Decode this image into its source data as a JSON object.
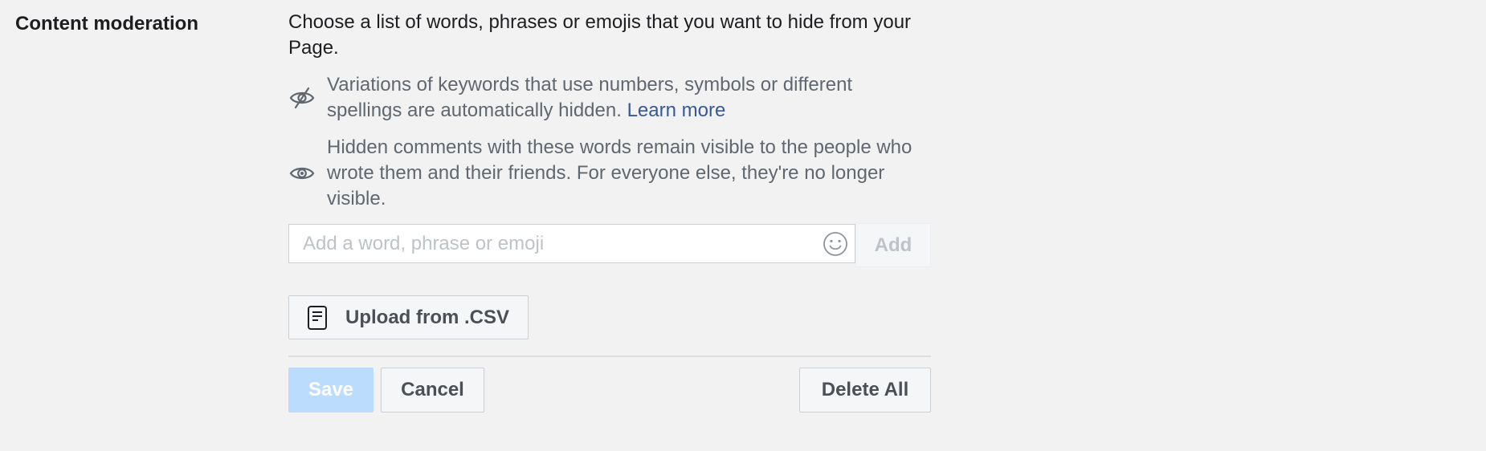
{
  "section": {
    "label": "Content moderation"
  },
  "intro": "Choose a list of words, phrases or emojis that you want to hide from your Page.",
  "info_items": [
    {
      "icon": "eye-slash-icon",
      "text": "Variations of keywords that use numbers, symbols or different spellings are automatically hidden.",
      "link": "Learn more"
    },
    {
      "icon": "eye-icon",
      "text": "Hidden comments with these words remain visible to the people who wrote them and their friends. For everyone else, they're no longer visible."
    }
  ],
  "word_input": {
    "value": "",
    "placeholder": "Add a word, phrase or emoji",
    "emoji_icon": "smiley-icon"
  },
  "add_button": {
    "label": "Add",
    "state": "disabled"
  },
  "upload_button": {
    "icon": "document-icon",
    "label": "Upload from .CSV"
  },
  "actions": {
    "save_label": "Save",
    "save_state": "disabled",
    "cancel_label": "Cancel",
    "delete_all_label": "Delete All"
  },
  "colors": {
    "background": "#f2f2f2",
    "link": "#385898",
    "save_disabled": "#bcdcfd",
    "secondary_text": "#606770"
  }
}
